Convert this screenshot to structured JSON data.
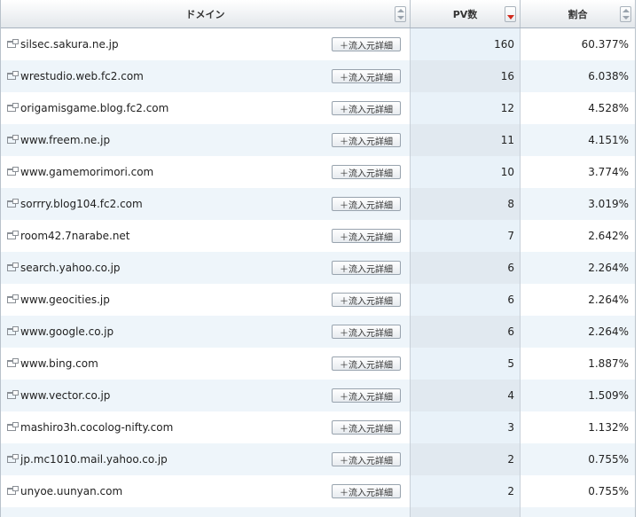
{
  "header": {
    "domain_label": "ドメイン",
    "pv_label": "PV数",
    "ratio_label": "割合"
  },
  "detail_button_label": "＋流入元詳細",
  "rows": [
    {
      "domain": "silsec.sakura.ne.jp",
      "pv": "160",
      "ratio": "60.377%"
    },
    {
      "domain": "wrestudio.web.fc2.com",
      "pv": "16",
      "ratio": "6.038%"
    },
    {
      "domain": "origamisgame.blog.fc2.com",
      "pv": "12",
      "ratio": "4.528%"
    },
    {
      "domain": "www.freem.ne.jp",
      "pv": "11",
      "ratio": "4.151%"
    },
    {
      "domain": "www.gamemorimori.com",
      "pv": "10",
      "ratio": "3.774%"
    },
    {
      "domain": "sorrry.blog104.fc2.com",
      "pv": "8",
      "ratio": "3.019%"
    },
    {
      "domain": "room42.7narabe.net",
      "pv": "7",
      "ratio": "2.642%"
    },
    {
      "domain": "search.yahoo.co.jp",
      "pv": "6",
      "ratio": "2.264%"
    },
    {
      "domain": "www.geocities.jp",
      "pv": "6",
      "ratio": "2.264%"
    },
    {
      "domain": "www.google.co.jp",
      "pv": "6",
      "ratio": "2.264%"
    },
    {
      "domain": "www.bing.com",
      "pv": "5",
      "ratio": "1.887%"
    },
    {
      "domain": "www.vector.co.jp",
      "pv": "4",
      "ratio": "1.509%"
    },
    {
      "domain": "mashiro3h.cocolog-nifty.com",
      "pv": "3",
      "ratio": "1.132%"
    },
    {
      "domain": "jp.mc1010.mail.yahoo.co.jp",
      "pv": "2",
      "ratio": "0.755%"
    },
    {
      "domain": "unyoe.uunyan.com",
      "pv": "2",
      "ratio": "0.755%"
    }
  ]
}
